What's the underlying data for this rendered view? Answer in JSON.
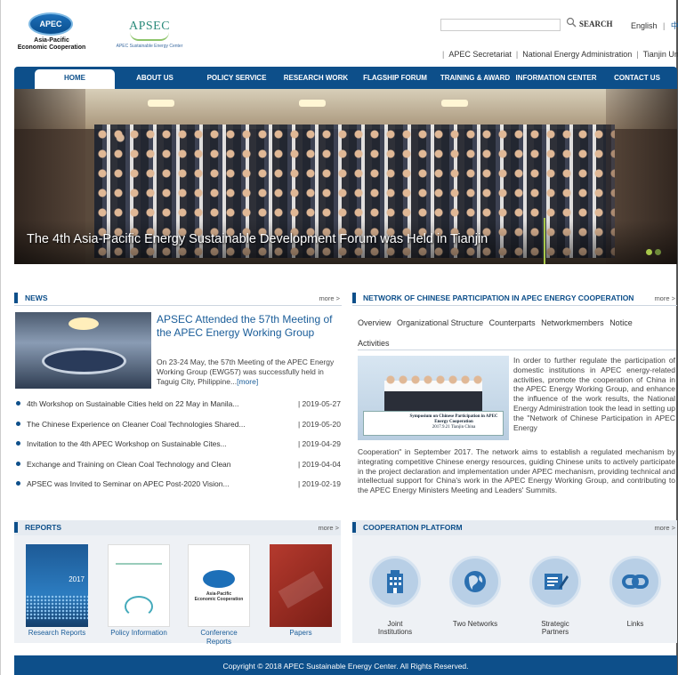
{
  "header": {
    "apec_logo_text": "APEC",
    "apec_subtitle_line1": "Asia-Pacific",
    "apec_subtitle_line2": "Economic Cooperation",
    "apsec_logo_text": "APSEC",
    "apsec_subtitle": "APEC Sustainable Energy Center",
    "search_placeholder": "",
    "search_label": "SEARCH",
    "lang_english": "English",
    "lang_sep": "|",
    "lang_chinese": "中文",
    "top_links": [
      "APEC Secretariat",
      "National Energy Administration",
      "Tianjin University"
    ]
  },
  "nav": {
    "items": [
      "HOME",
      "ABOUT US",
      "POLICY SERVICE",
      "RESEARCH WORK",
      "FLAGSHIP FORUM",
      "TRAINING & AWARD",
      "INFORMATION CENTER",
      "CONTACT US"
    ],
    "active": "HOME"
  },
  "banner": {
    "caption": "The 4th Asia-Pacific Energy Sustainable Development Forum was Held in Tianjin",
    "active_dot": 1,
    "colors": {
      "active_dot": "#a8c84a",
      "inactive_dot": "#6e8a3a"
    }
  },
  "news": {
    "title": "NEWS",
    "more": "more >",
    "featured_title": "APSEC Attended the 57th Meeting of the APEC Energy Working Group",
    "featured_desc": "On 23-24 May, the 57th Meeting of the APEC Energy Working Group (EWG57) was successfully held in Taguig City, Philippine...",
    "featured_more": "[more]",
    "items": [
      {
        "text": "4th Workshop on Sustainable Cities held on 22 May in Manila...",
        "date": "| 2019-05-27"
      },
      {
        "text": "The Chinese Experience on Cleaner Coal Technologies Shared...",
        "date": "| 2019-05-20"
      },
      {
        "text": "Invitation to the 4th APEC Workshop on Sustainable Cites...",
        "date": "| 2019-04-29"
      },
      {
        "text": "Exchange and Training on Clean Coal Technology and Clean",
        "date": "| 2019-04-04"
      },
      {
        "text": "APSEC was Invited to Seminar on APEC Post-2020 Vision...",
        "date": "| 2019-02-19"
      }
    ]
  },
  "network": {
    "title": "NETWORK OF CHINESE PARTICIPATION IN APEC ENERGY COOPERATION",
    "more": "more >",
    "tabs": [
      "Overview",
      "Organizational Structure",
      "Counterparts",
      "Networkmembers",
      "Notice",
      "Activities"
    ],
    "board_text": "Symposium on Chinese Participation in APEC Energy Cooperation",
    "board_date": "2017.9.21 Tianjin China",
    "text_side": "In order to further regulate the participation of domestic institutions in APEC energy-related activities, promote the cooperation of China in the APEC Energy Working Group, and enhance the influence of the work results, the National Energy Administration took the lead in setting up the \"Network of Chinese Participation in APEC Energy",
    "text_bottom": "Cooperation\" in September 2017. The network aims to establish a regulated mechanism by integrating competitive Chinese energy resources, guiding Chinese units to actively participate in the project declaration and implementation under APEC mechanism, providing technical and intellectual support for China's work in the APEC Energy Working Group, and contributing to the APEC Energy Ministers Meeting and Leaders' Summits."
  },
  "reports": {
    "title": "REPORTS",
    "more": "more >",
    "items": [
      {
        "label": "Research Reports",
        "cover_year": "2017"
      },
      {
        "label": "Policy Information",
        "cover_year": ""
      },
      {
        "label": "Conference Reports",
        "cover_year": ""
      },
      {
        "label": "Papers",
        "cover_year": ""
      }
    ]
  },
  "coop": {
    "title": "COOPERATION PLATFORM",
    "more": "more >",
    "items": [
      {
        "label": "Joint Institutions",
        "icon": "building-icon"
      },
      {
        "label": "Two Networks",
        "icon": "globe-icon"
      },
      {
        "label": "Strategic Partners",
        "icon": "book-pen-icon"
      },
      {
        "label": "Links",
        "icon": "link-icon"
      }
    ]
  },
  "footer": {
    "copyright": "Copyright © 2018 APEC Sustainable Energy Center. All Rights Reserved."
  }
}
